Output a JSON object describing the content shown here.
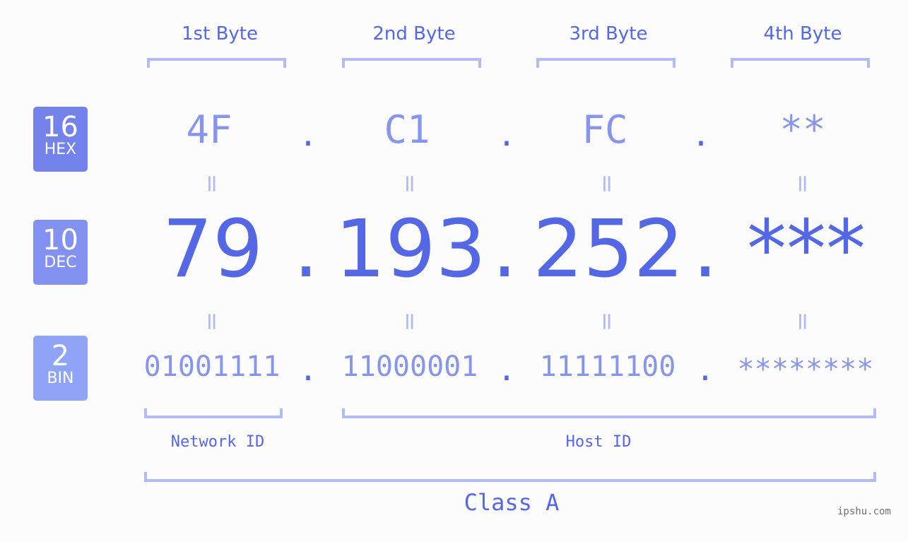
{
  "bytes": [
    {
      "label": "1st Byte",
      "hex": "4F",
      "dec": "79",
      "bin": "01001111"
    },
    {
      "label": "2nd Byte",
      "hex": "C1",
      "dec": "193",
      "bin": "11000001"
    },
    {
      "label": "3rd Byte",
      "hex": "FC",
      "dec": "252",
      "bin": "11111100"
    },
    {
      "label": "4th Byte",
      "hex": "**",
      "dec": "***",
      "bin": "********"
    }
  ],
  "separator": ".",
  "equals": "=",
  "badges": {
    "hex": {
      "num": "16",
      "label": "HEX",
      "color": "#7482ec"
    },
    "dec": {
      "num": "10",
      "label": "DEC",
      "color": "#8391f0"
    },
    "bin": {
      "num": "2",
      "label": "BIN",
      "color": "#8fa4f7"
    }
  },
  "segments": {
    "network": "Network ID",
    "host": "Host ID",
    "class": "Class A"
  },
  "watermark": "ipshu.com",
  "colors": {
    "accent": "#5468e6",
    "light": "#8795ef",
    "bracket": "#b1bcf6"
  }
}
